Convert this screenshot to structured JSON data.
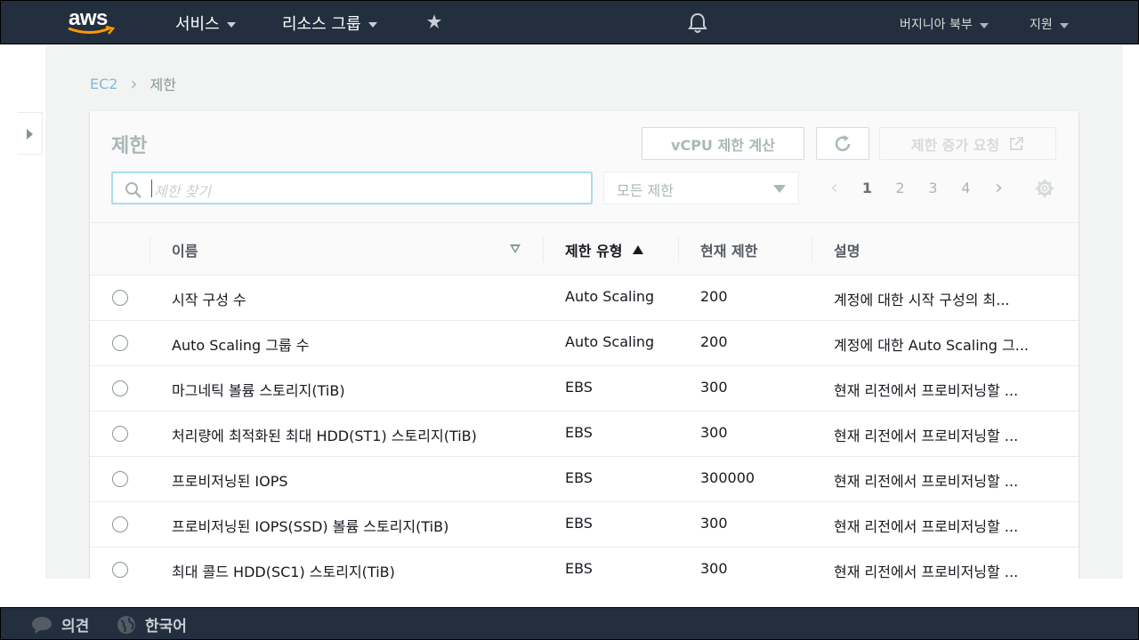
{
  "nav": {
    "logo_text": "aws",
    "services": "서비스",
    "resource_groups": "리소스 그룹",
    "region": "버지니아 북부",
    "support": "지원"
  },
  "breadcrumb": {
    "root": "EC2",
    "current": "제한"
  },
  "panel": {
    "title": "제한",
    "vcpu_button": "vCPU 제한 계산",
    "increase_button": "제한 증가 요청",
    "search_placeholder": "제한 찾기",
    "filter_value": "모든 제한",
    "pages": [
      "1",
      "2",
      "3",
      "4"
    ],
    "current_page": "1"
  },
  "table": {
    "headers": {
      "name": "이름",
      "type": "제한 유형",
      "current": "현재 제한",
      "description": "설명"
    },
    "rows": [
      {
        "name": "시작 구성 수",
        "type": "Auto Scaling",
        "current": "200",
        "description": "계정에 대한 시작 구성의 최..."
      },
      {
        "name": "Auto Scaling 그룹 수",
        "type": "Auto Scaling",
        "current": "200",
        "description": "계정에 대한 Auto Scaling 그..."
      },
      {
        "name": "마그네틱 볼륨 스토리지(TiB)",
        "type": "EBS",
        "current": "300",
        "description": "현재 리전에서 프로비저닝할 ..."
      },
      {
        "name": "처리량에 최적화된 최대 HDD(ST1) 스토리지(TiB)",
        "type": "EBS",
        "current": "300",
        "description": "현재 리전에서 프로비저닝할 ..."
      },
      {
        "name": "프로비저닝된 IOPS",
        "type": "EBS",
        "current": "300000",
        "description": "현재 리전에서 프로비저닝할 ..."
      },
      {
        "name": "프로비저닝된 IOPS(SSD) 볼륨 스토리지(TiB)",
        "type": "EBS",
        "current": "300",
        "description": "현재 리전에서 프로비저닝할 ..."
      },
      {
        "name": "최대 콜드 HDD(SC1) 스토리지(TiB)",
        "type": "EBS",
        "current": "300",
        "description": "현재 리전에서 프로비저닝할 ..."
      }
    ]
  },
  "footer": {
    "feedback": "의견",
    "language": "한국어"
  },
  "colors": {
    "nav_bg": "#232f3e",
    "accent": "#0073bb",
    "main_bg": "#f2f3f3"
  }
}
